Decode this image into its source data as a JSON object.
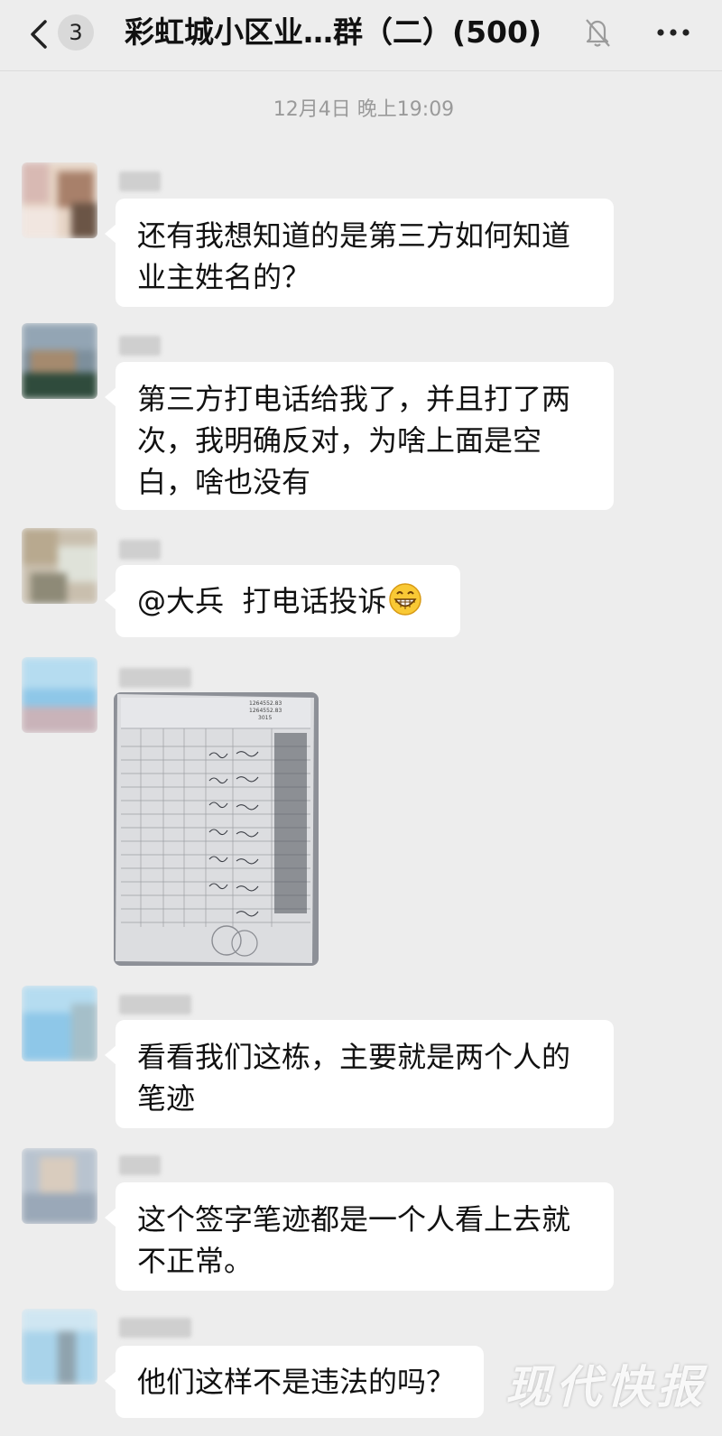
{
  "header": {
    "unread_count": "3",
    "title": "彩虹城小区业…群（二）(500)"
  },
  "timestamp": "12月4日 晚上19:09",
  "messages": [
    {
      "type": "text",
      "text": "还有我想知道的是第三方如何知道\n业主姓名的？"
    },
    {
      "type": "text",
      "text": "第三方打电话给我了，并且打了两\n次，我明确反对，为啥上面是空\n白，啥也没有"
    },
    {
      "type": "text",
      "text": "@大兵  打电话投诉",
      "emoji": "grinning-face-icon"
    },
    {
      "type": "image",
      "content": "photo of signature sheet"
    },
    {
      "type": "text",
      "text": "看看我们这栋，主要就是两个人的\n笔迹"
    },
    {
      "type": "text",
      "text": "这个签字笔迹都是一个人看上去就\n不正常。"
    },
    {
      "type": "text",
      "text": "他们这样不是违法的吗？"
    }
  ],
  "photo": {
    "header_values": [
      "1264552.83",
      "1264552.83",
      "3015"
    ]
  },
  "watermark": "现代快报",
  "colors": {
    "background": "#ededed",
    "bubble": "#ffffff",
    "timestamp": "#9a9a9a"
  }
}
